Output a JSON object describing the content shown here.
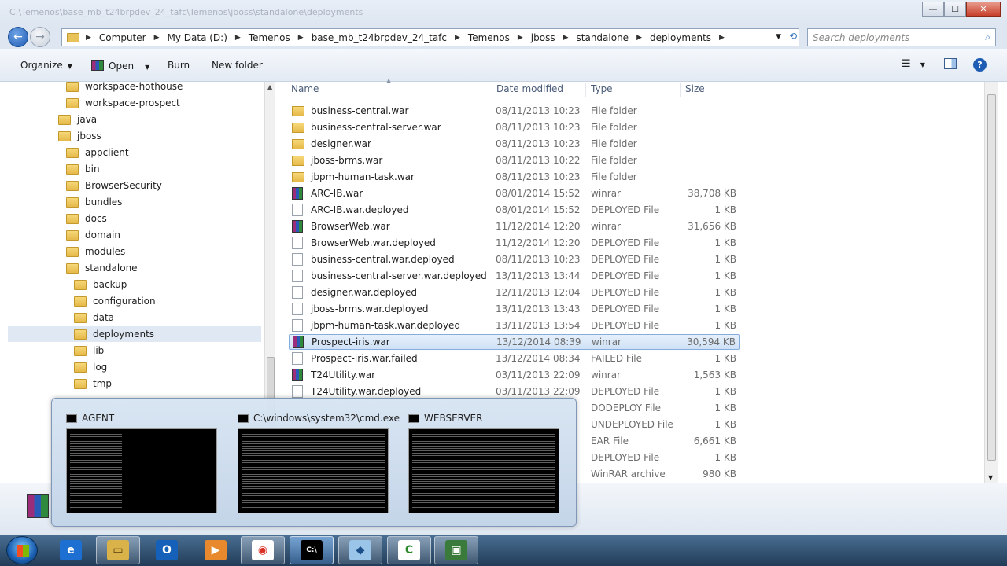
{
  "window": {
    "title": "C:\\Temenos\\base_mb_t24brpdev_24_tafc\\Temenos\\jboss\\standalone\\deployments",
    "minimize": "—",
    "maximize": "☐",
    "close": "✕"
  },
  "address": {
    "crumbs": [
      "Computer",
      "My Data (D:)",
      "Temenos",
      "base_mb_t24brpdev_24_tafc",
      "Temenos",
      "jboss",
      "standalone",
      "deployments"
    ],
    "search_placeholder": "Search deployments"
  },
  "toolbar": {
    "organize": "Organize",
    "open": "Open",
    "burn": "Burn",
    "new_folder": "New folder"
  },
  "tree": {
    "items": [
      {
        "label": "workspace-hothouse"
      },
      {
        "label": "workspace-prospect"
      },
      {
        "label": "java"
      },
      {
        "label": "jboss"
      },
      {
        "label": "appclient"
      },
      {
        "label": "bin"
      },
      {
        "label": "BrowserSecurity"
      },
      {
        "label": "bundles"
      },
      {
        "label": "docs"
      },
      {
        "label": "domain"
      },
      {
        "label": "modules"
      },
      {
        "label": "standalone"
      },
      {
        "label": "backup"
      },
      {
        "label": "configuration"
      },
      {
        "label": "data"
      },
      {
        "label": "deployments"
      },
      {
        "label": "lib"
      },
      {
        "label": "log"
      },
      {
        "label": "tmp"
      }
    ]
  },
  "columns": {
    "name": "Name",
    "date": "Date modified",
    "type": "Type",
    "size": "Size"
  },
  "files": [
    {
      "name": "business-central.war",
      "date": "08/11/2013 10:23",
      "type": "File folder",
      "size": "",
      "icon": "folder"
    },
    {
      "name": "business-central-server.war",
      "date": "08/11/2013 10:23",
      "type": "File folder",
      "size": "",
      "icon": "folder"
    },
    {
      "name": "designer.war",
      "date": "08/11/2013 10:23",
      "type": "File folder",
      "size": "",
      "icon": "folder"
    },
    {
      "name": "jboss-brms.war",
      "date": "08/11/2013 10:22",
      "type": "File folder",
      "size": "",
      "icon": "folder"
    },
    {
      "name": "jbpm-human-task.war",
      "date": "08/11/2013 10:23",
      "type": "File folder",
      "size": "",
      "icon": "folder"
    },
    {
      "name": "ARC-IB.war",
      "date": "08/01/2014 15:52",
      "type": "winrar",
      "size": "38,708 KB",
      "icon": "rar"
    },
    {
      "name": "ARC-IB.war.deployed",
      "date": "08/01/2014 15:52",
      "type": "DEPLOYED File",
      "size": "1 KB",
      "icon": "blank"
    },
    {
      "name": "BrowserWeb.war",
      "date": "11/12/2014 12:20",
      "type": "winrar",
      "size": "31,656 KB",
      "icon": "rar"
    },
    {
      "name": "BrowserWeb.war.deployed",
      "date": "11/12/2014 12:20",
      "type": "DEPLOYED File",
      "size": "1 KB",
      "icon": "blank"
    },
    {
      "name": "business-central.war.deployed",
      "date": "08/11/2013 10:23",
      "type": "DEPLOYED File",
      "size": "1 KB",
      "icon": "blank"
    },
    {
      "name": "business-central-server.war.deployed",
      "date": "13/11/2013 13:44",
      "type": "DEPLOYED File",
      "size": "1 KB",
      "icon": "blank"
    },
    {
      "name": "designer.war.deployed",
      "date": "12/11/2013 12:04",
      "type": "DEPLOYED File",
      "size": "1 KB",
      "icon": "blank"
    },
    {
      "name": "jboss-brms.war.deployed",
      "date": "13/11/2013 13:43",
      "type": "DEPLOYED File",
      "size": "1 KB",
      "icon": "blank"
    },
    {
      "name": "jbpm-human-task.war.deployed",
      "date": "13/11/2013 13:54",
      "type": "DEPLOYED File",
      "size": "1 KB",
      "icon": "blank"
    },
    {
      "name": "Prospect-iris.war",
      "date": "13/12/2014 08:39",
      "type": "winrar",
      "size": "30,594 KB",
      "icon": "rar",
      "selected": true
    },
    {
      "name": "Prospect-iris.war.failed",
      "date": "13/12/2014 08:34",
      "type": "FAILED File",
      "size": "1 KB",
      "icon": "blank"
    },
    {
      "name": "T24Utility.war",
      "date": "03/11/2013 22:09",
      "type": "winrar",
      "size": "1,563 KB",
      "icon": "rar"
    },
    {
      "name": "T24Utility.war.deployed",
      "date": "03/11/2013 22:09",
      "type": "DEPLOYED File",
      "size": "1 KB",
      "icon": "blank"
    },
    {
      "name": "",
      "date": "",
      "type": "DODEPLOY File",
      "size": "1 KB",
      "icon": "none"
    },
    {
      "name": "",
      "date": "",
      "type": "UNDEPLOYED File",
      "size": "1 KB",
      "icon": "none"
    },
    {
      "name": "",
      "date": "",
      "type": "EAR File",
      "size": "6,661 KB",
      "icon": "none"
    },
    {
      "name": "",
      "date": "",
      "type": "DEPLOYED File",
      "size": "1 KB",
      "icon": "none"
    },
    {
      "name": "",
      "date": "",
      "type": "WinRAR archive",
      "size": "980 KB",
      "icon": "none"
    }
  ],
  "thumbnails": [
    {
      "title": "AGENT"
    },
    {
      "title": "C:\\windows\\system32\\cmd.exe"
    },
    {
      "title": "WEBSERVER"
    }
  ],
  "taskbar": {
    "apps": [
      {
        "name": "internet-explorer",
        "glyph": "e"
      },
      {
        "name": "windows-explorer",
        "glyph": "▭"
      },
      {
        "name": "outlook",
        "glyph": "O"
      },
      {
        "name": "media-player",
        "glyph": "▶"
      },
      {
        "name": "chrome",
        "glyph": "◉"
      },
      {
        "name": "command-prompt",
        "glyph": "C:\\"
      },
      {
        "name": "virtualbox",
        "glyph": "◆"
      },
      {
        "name": "cygwin",
        "glyph": "C"
      },
      {
        "name": "monitor-app",
        "glyph": "▣"
      }
    ]
  }
}
